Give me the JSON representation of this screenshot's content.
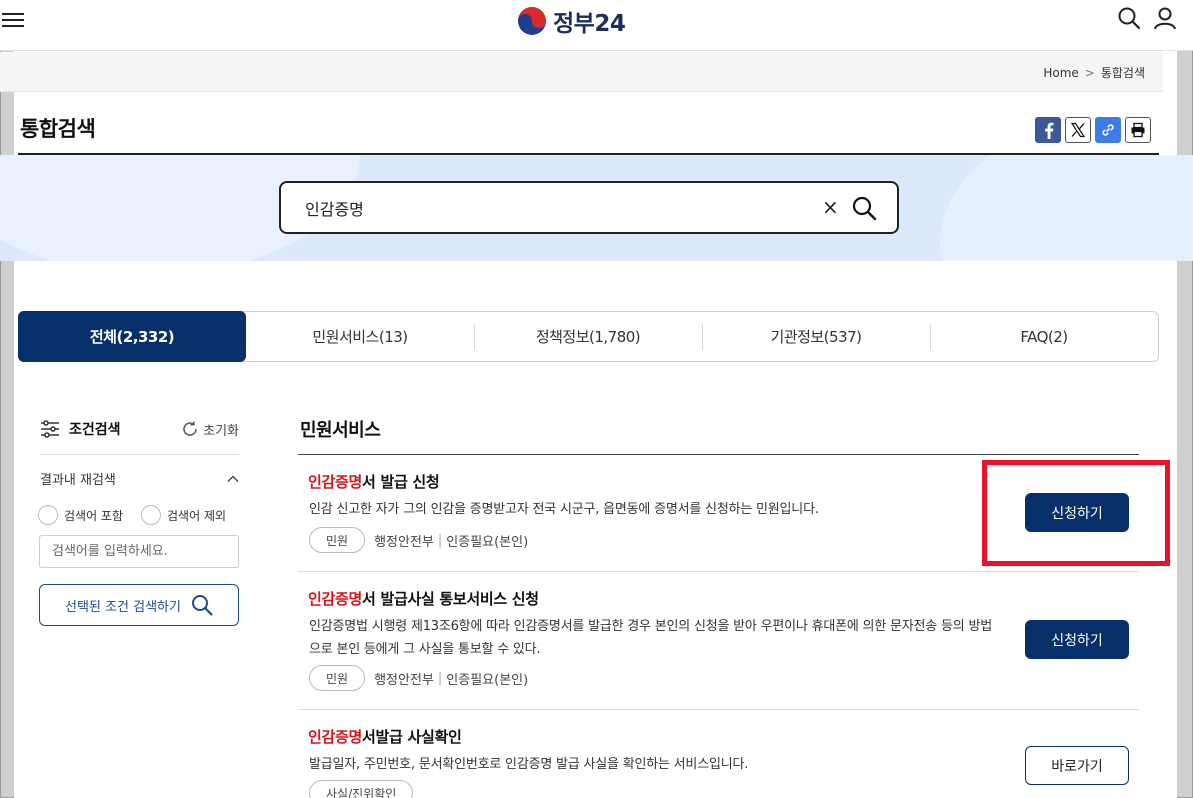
{
  "header": {
    "logo_text": "정부24",
    "menu_icon": "hamburger-menu-icon",
    "search_icon": "search-icon",
    "user_icon": "user-icon"
  },
  "breadcrumb": {
    "home": "Home",
    "separator": ">",
    "current": "통합검색"
  },
  "page_title": "통합검색",
  "share": [
    "facebook-icon",
    "x-twitter-icon",
    "link-icon",
    "print-icon"
  ],
  "search": {
    "value": "인감증명",
    "clear_symbol": "×"
  },
  "tabs": [
    {
      "label": "전체(2,332)",
      "active": true
    },
    {
      "label": "민원서비스(13)",
      "active": false
    },
    {
      "label": "정책정보(1,780)",
      "active": false
    },
    {
      "label": "기관정보(537)",
      "active": false
    },
    {
      "label": "FAQ(2)",
      "active": false
    }
  ],
  "filter": {
    "title": "조건검색",
    "reset_label": "초기화",
    "refine_label": "결과내 재검색",
    "include_label": "검색어 포함",
    "exclude_label": "검색어 제외",
    "input_placeholder": "검색어를 입력하세요.",
    "apply_label": "선택된 조건 검색하기"
  },
  "results": {
    "section_title": "민원서비스",
    "items": [
      {
        "title_highlight": "인감증명",
        "title_rest": "서 발급 신청",
        "desc": "인감 신고한 자가 그의 인감을 증명받고자 전국 시군구, 읍면동에 증명서를 신청하는 민원입니다.",
        "tag": "민원",
        "org": "행정안전부",
        "sep": "|",
        "auth": "인증필요(본인)",
        "button": "신청하기"
      },
      {
        "title_highlight": "인감증명",
        "title_rest": "서 발급사실 통보서비스 신청",
        "desc": "인감증명법 시행령 제13조6항에 따라 인감증명서를 발급한 경우 본인의 신청을 받아 우편이나 휴대폰에 의한 문자전송 등의 방법으로 본인 등에게 그 사실을 통보할 수 있다.",
        "tag": "민원",
        "org": "행정안전부",
        "sep": "|",
        "auth": "인증필요(본인)",
        "button": "신청하기"
      },
      {
        "title_highlight": "인감증명",
        "title_rest": "서발급 사실확인",
        "desc": "발급일자, 주민번호, 문서확인번호로 인감증명 발급 사실을 확인하는 서비스입니다.",
        "tag": "사실/진위확인",
        "button": "바로가기"
      }
    ]
  },
  "colors": {
    "brand_navy": "#07306b",
    "highlight_red": "#d6141c",
    "annotation_box": "#e8132a",
    "band_blue": "#dbe9fb"
  }
}
